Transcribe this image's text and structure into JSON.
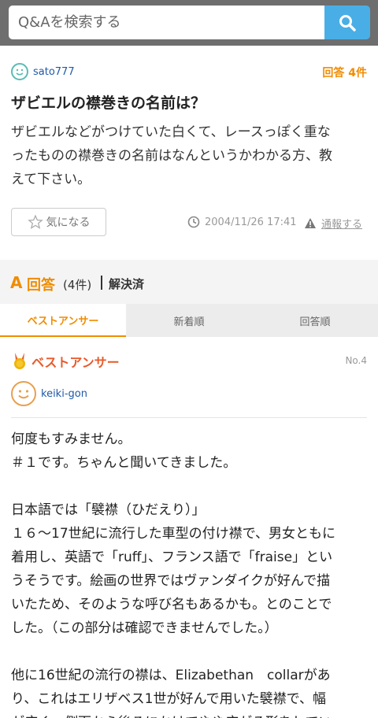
{
  "search": {
    "placeholder": "Q&Aを検索する",
    "button_icon": "search-icon"
  },
  "question": {
    "username": "sato777",
    "answer_count": "回答 4件",
    "title": "ザビエルの襟巻きの名前は？",
    "body_lines": [
      "ザビエルなどがつけていた白くて、レースっぽく重な",
      "ったものの襟巻きの名前はなんというかわかる方、教",
      "えて下さい。"
    ],
    "bookmark_label": "気になる",
    "date": "2004/11/26 17:41",
    "report_label": "通報する"
  },
  "answers_header": {
    "a_mark": "A",
    "label": "回答",
    "count": "(4件)",
    "status": "解決済"
  },
  "tabs": [
    "ベストアンサー",
    "新着順",
    "回答順"
  ],
  "best_answer": {
    "label": "ベストアンサー",
    "number": "No.4",
    "username": "keiki-gon",
    "body_lines": [
      "何度もすみません。",
      "＃１です。ちゃんと聞いてきました。",
      "",
      "日本語では「襞襟（ひだえり）」",
      "１６～17世紀に流行した車型の付け襟で、男女ともに",
      "着用し、英語で「ruff」、フランス語で「fraise」とい",
      "うそうです。絵画の世界ではヴァンダイクが好んで描",
      "いたため、そのような呼び名もあるかも。とのことで",
      "した。（この部分は確認できませんでした。）",
      "",
      "他に16世紀の流行の襟は、Elizabethan　collarがあ",
      "り、これはエリザベス1世が好んで用いた襞襟で、幅",
      "が広く、側面から後ろにかけてやや広がる形をしてい"
    ]
  },
  "colors": {
    "accent": "#f08c00",
    "search_button": "#4aaee6",
    "link": "#1e5aa8",
    "best": "#e85a2a"
  }
}
